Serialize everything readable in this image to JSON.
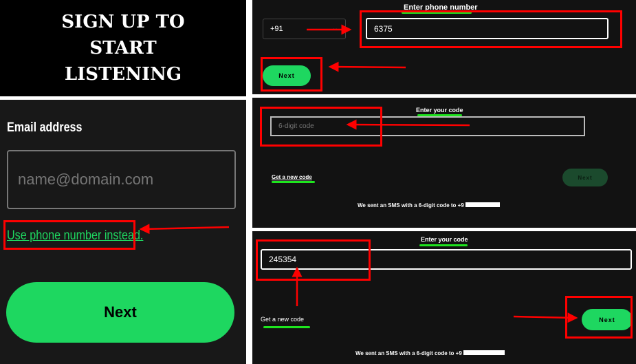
{
  "title_banner": {
    "text": "SIGN UP TO START LISTENING"
  },
  "email_step": {
    "label": "Email address",
    "placeholder": "name@domain.com",
    "phone_link": "Use phone number instead.",
    "next": "Next"
  },
  "phone_step": {
    "heading": "Enter phone number",
    "country_code": "+91",
    "phone_value": "6375",
    "next": "Next"
  },
  "code_step_empty": {
    "heading": "Enter your code",
    "placeholder": "6-digit code",
    "new_code": "Get a new code",
    "next": "Next",
    "sms_text": "We sent an SMS with a 6-digit code to +9"
  },
  "code_step_filled": {
    "heading": "Enter your code",
    "code_value": "245354",
    "new_code": "Get a new code",
    "next": "Next",
    "sms_text": "We sent an SMS with a 6-digit code to +9"
  },
  "colors": {
    "spotify_green": "#1ed760",
    "annotation_red": "#ff0000",
    "underline_green": "#1ee51e",
    "background": "#121212"
  }
}
